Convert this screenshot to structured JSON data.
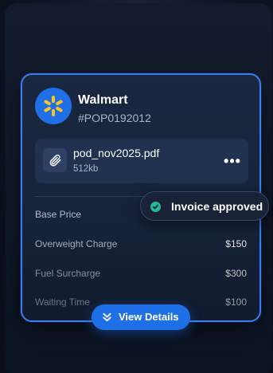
{
  "company": {
    "name": "Walmart",
    "id": "#POP0192012",
    "logo_icon": "walmart-spark-icon",
    "brand_color": "#1f6fe6",
    "spark_color": "#ffc220"
  },
  "file": {
    "name": "pod_nov2025.pdf",
    "size": "512kb",
    "icon": "paperclip-icon",
    "menu_icon": "more-dots-icon",
    "menu_label": "•••"
  },
  "charges": [
    {
      "label": "Base Price",
      "value": ""
    },
    {
      "label": "Overweight Charge",
      "value": "$150"
    },
    {
      "label": "Fuel Surcharge",
      "value": "$300"
    },
    {
      "label": "Waiting Time",
      "value": "$100"
    }
  ],
  "toast": {
    "text": "Invoice approved",
    "icon": "check-circle-icon",
    "status_color": "#23b89a"
  },
  "action": {
    "label": "View Details",
    "icon": "chevrons-down-icon"
  }
}
